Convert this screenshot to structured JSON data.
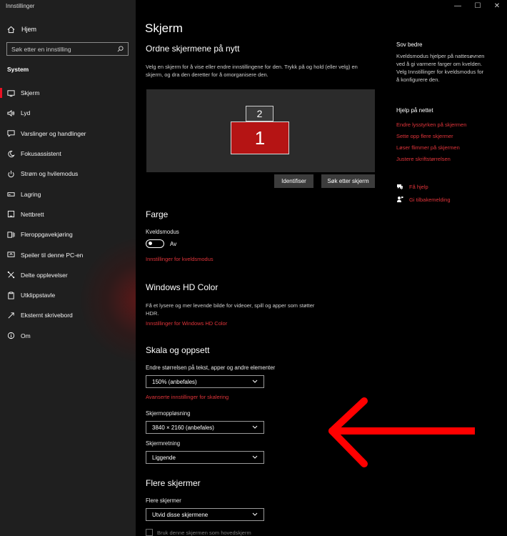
{
  "app_title": "Innstillinger",
  "window_controls": {
    "minimize": "—",
    "maximize": "☐",
    "close": "✕"
  },
  "sidebar": {
    "home": "Hjem",
    "search_placeholder": "Søk etter en innstilling",
    "section": "System",
    "items": [
      {
        "label": "Skjerm",
        "icon": "monitor-icon",
        "active": true
      },
      {
        "label": "Lyd",
        "icon": "speaker-icon"
      },
      {
        "label": "Varslinger og handlinger",
        "icon": "notification-icon"
      },
      {
        "label": "Fokusassistent",
        "icon": "moon-icon"
      },
      {
        "label": "Strøm og hvilemodus",
        "icon": "power-icon"
      },
      {
        "label": "Lagring",
        "icon": "storage-icon"
      },
      {
        "label": "Nettbrett",
        "icon": "tablet-icon"
      },
      {
        "label": "Fleroppgavekjøring",
        "icon": "multitasking-icon"
      },
      {
        "label": "Speiler til denne PC-en",
        "icon": "project-icon"
      },
      {
        "label": "Delte opplevelser",
        "icon": "shared-icon"
      },
      {
        "label": "Utklippstavle",
        "icon": "clipboard-icon"
      },
      {
        "label": "Eksternt skrivebord",
        "icon": "remote-icon"
      },
      {
        "label": "Om",
        "icon": "info-icon"
      }
    ]
  },
  "main": {
    "title": "Skjerm",
    "arrange": {
      "heading": "Ordne skjermene på nytt",
      "desc_line1": "Velg en skjerm for å vise eller endre innstillingene for den. Trykk på og hold (eller velg) en",
      "desc_line2": "skjerm, og dra den deretter for å omorganisere den.",
      "monitor1": "1",
      "monitor2": "2",
      "identify_button": "Identifiser",
      "detect_button": "Søk etter skjerm"
    },
    "color": {
      "heading": "Farge",
      "night_label": "Kveldsmodus",
      "toggle_state": "Av",
      "night_link": "Innstillinger for kveldsmodus"
    },
    "hd": {
      "heading": "Windows HD Color",
      "desc_line1": "Få et lysere og mer levende bilde for videoer, spill og apper som støtter",
      "desc_line2": "HDR.",
      "link": "Innstillinger for Windows HD Color"
    },
    "scale": {
      "heading": "Skala og oppsett",
      "size_label": "Endre størrelsen på tekst, apper og andre elementer",
      "size_value": "150% (anbefales)",
      "advanced_link": "Avanserte innstillinger for skalering",
      "resolution_label": "Skjermoppløsning",
      "resolution_value": "3840 × 2160 (anbefales)",
      "orientation_label": "Skjermretning",
      "orientation_value": "Liggende"
    },
    "multi": {
      "heading": "Flere skjermer",
      "label": "Flere skjermer",
      "value": "Utvid disse skjermene",
      "main_checkbox": "Bruk denne skjermen som hovedskjerm"
    }
  },
  "right": {
    "sleep_heading": "Sov bedre",
    "sleep_line1": "Kveldsmodus hjelper på nattesøvnen",
    "sleep_line2": "ved å gi varmere farger om kvelden.",
    "sleep_line3": "Velg Innstillinger for kveldsmodus for",
    "sleep_line4": "å konfigurere den.",
    "help_heading": "Hjelp på nettet",
    "help_links": [
      "Endre lysstyrken på skjermen",
      "Sette opp flere skjermer",
      "Løser flimmer på skjermen",
      "Justere skriftstørrelsen"
    ],
    "get_help": "Få hjelp",
    "feedback": "Gi tilbakemelding"
  },
  "colors": {
    "accent": "#e0343a",
    "sidebar_bg": "#1f1f1f",
    "arrow": "#ff0000"
  }
}
